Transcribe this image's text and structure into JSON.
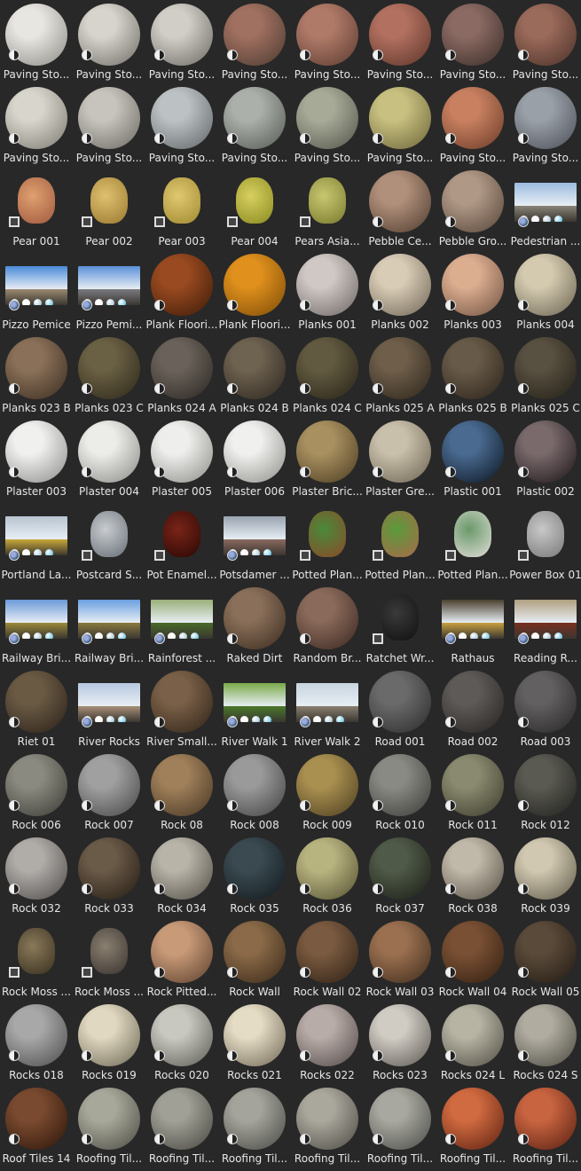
{
  "asset_browser": {
    "columns": 8,
    "items": [
      {
        "label": "Paving Sto...",
        "kind": "sphere",
        "c1": "#e8e6e0",
        "c2": "#8c8a84",
        "badge": "material"
      },
      {
        "label": "Paving Sto...",
        "kind": "sphere",
        "c1": "#d6d4cc",
        "c2": "#6e6c66",
        "badge": "material"
      },
      {
        "label": "Paving Sto...",
        "kind": "sphere",
        "c1": "#d0cec6",
        "c2": "#6a6862",
        "badge": "material"
      },
      {
        "label": "Paving Sto...",
        "kind": "sphere",
        "c1": "#a07060",
        "c2": "#4a3a30",
        "badge": "material"
      },
      {
        "label": "Paving Sto...",
        "kind": "sphere",
        "c1": "#b07a68",
        "c2": "#5a3a30",
        "badge": "material"
      },
      {
        "label": "Paving Sto...",
        "kind": "sphere",
        "c1": "#b27060",
        "c2": "#5a3428",
        "badge": "material"
      },
      {
        "label": "Paving Sto...",
        "kind": "sphere",
        "c1": "#8a6a62",
        "c2": "#3a2c28",
        "badge": "material"
      },
      {
        "label": "Paving Sto...",
        "kind": "sphere",
        "c1": "#9a6a5a",
        "c2": "#4a3028",
        "badge": "material"
      },
      {
        "label": "Paving Sto...",
        "kind": "sphere",
        "c1": "#d8d6cc",
        "c2": "#7a7870",
        "badge": "material"
      },
      {
        "label": "Paving Sto...",
        "kind": "sphere",
        "c1": "#c6c4bc",
        "c2": "#6a6862",
        "badge": "material"
      },
      {
        "label": "Paving Sto...",
        "kind": "sphere",
        "c1": "#bcc2c4",
        "c2": "#5e6466",
        "badge": "material"
      },
      {
        "label": "Paving Sto...",
        "kind": "sphere",
        "c1": "#acb0aa",
        "c2": "#545852",
        "badge": "material"
      },
      {
        "label": "Paving Sto...",
        "kind": "sphere",
        "c1": "#a8aa98",
        "c2": "#52544a",
        "badge": "material"
      },
      {
        "label": "Paving Sto...",
        "kind": "sphere",
        "c1": "#c8c080",
        "c2": "#6a6438",
        "badge": "material"
      },
      {
        "label": "Paving Sto...",
        "kind": "sphere",
        "c1": "#c88060",
        "c2": "#6a3a28",
        "badge": "material"
      },
      {
        "label": "Paving Sto...",
        "kind": "sphere",
        "c1": "#9aa0a8",
        "c2": "#4a4e56",
        "badge": "material"
      },
      {
        "label": "Pear 001",
        "kind": "object",
        "c1": "#e0a070",
        "c2": "#a05a40",
        "badge": "object"
      },
      {
        "label": "Pear 002",
        "kind": "object",
        "c1": "#e0c070",
        "c2": "#9a7a30",
        "badge": "object"
      },
      {
        "label": "Pear 003",
        "kind": "object",
        "c1": "#e0c870",
        "c2": "#a08a30",
        "badge": "object"
      },
      {
        "label": "Pear 004",
        "kind": "object",
        "c1": "#d8d060",
        "c2": "#8a8a20",
        "badge": "object"
      },
      {
        "label": "Pears Asia...",
        "kind": "object",
        "c1": "#c8c870",
        "c2": "#7a7a30",
        "badge": "object"
      },
      {
        "label": "Pebble Ce...",
        "kind": "sphere",
        "c1": "#b0907a",
        "c2": "#4e3a2e",
        "badge": "material"
      },
      {
        "label": "Pebble Gro...",
        "kind": "sphere",
        "c1": "#b09886",
        "c2": "#544438",
        "badge": "material"
      },
      {
        "label": "Pedestrian ...",
        "kind": "pano",
        "c1": "#9cbce0",
        "c2": "#8a8478",
        "badge": "world"
      },
      {
        "label": "Pizzo Pemice",
        "kind": "pano",
        "c1": "#4a8ad8",
        "c2": "#9a8a70",
        "badge": "world"
      },
      {
        "label": "Pizzo Pemi...",
        "kind": "pano",
        "c1": "#5a90d8",
        "c2": "#7a7a80",
        "badge": "world"
      },
      {
        "label": "Plank Floori...",
        "kind": "sphere",
        "c1": "#9a4a20",
        "c2": "#3a1a08",
        "badge": "material"
      },
      {
        "label": "Plank Floori...",
        "kind": "sphere",
        "c1": "#e0901c",
        "c2": "#7a4a08",
        "badge": "material"
      },
      {
        "label": "Planks 001",
        "kind": "sphere",
        "c1": "#d0c8c4",
        "c2": "#6a6460",
        "badge": "material"
      },
      {
        "label": "Planks 002",
        "kind": "sphere",
        "c1": "#d8ccb6",
        "c2": "#6e6454",
        "badge": "material"
      },
      {
        "label": "Planks 003",
        "kind": "sphere",
        "c1": "#dcae90",
        "c2": "#6e5040",
        "badge": "material"
      },
      {
        "label": "Planks 004",
        "kind": "sphere",
        "c1": "#d4cab0",
        "c2": "#6a6250",
        "badge": "material"
      },
      {
        "label": "Planks 023  B",
        "kind": "sphere",
        "c1": "#8a7058",
        "c2": "#3a2c20",
        "badge": "material"
      },
      {
        "label": "Planks 023  C",
        "kind": "sphere",
        "c1": "#6a6044",
        "c2": "#2a2618",
        "badge": "material"
      },
      {
        "label": "Planks 024  A",
        "kind": "sphere",
        "c1": "#6a625a",
        "c2": "#2a2622",
        "badge": "material"
      },
      {
        "label": "Planks 024  B",
        "kind": "sphere",
        "c1": "#6e6250",
        "c2": "#2c261e",
        "badge": "material"
      },
      {
        "label": "Planks 024  C",
        "kind": "sphere",
        "c1": "#625a40",
        "c2": "#262216",
        "badge": "material"
      },
      {
        "label": "Planks 025  A",
        "kind": "sphere",
        "c1": "#6e5e4a",
        "c2": "#2c241a",
        "badge": "material"
      },
      {
        "label": "Planks 025  B",
        "kind": "sphere",
        "c1": "#685a48",
        "c2": "#2a2218",
        "badge": "material"
      },
      {
        "label": "Planks 025  C",
        "kind": "sphere",
        "c1": "#585040",
        "c2": "#221e16",
        "badge": "material"
      },
      {
        "label": "Plaster 003",
        "kind": "sphere",
        "c1": "#f0f0ee",
        "c2": "#8a8a88",
        "badge": "material"
      },
      {
        "label": "Plaster 004",
        "kind": "sphere",
        "c1": "#ecece8",
        "c2": "#888884",
        "badge": "material"
      },
      {
        "label": "Plaster 005",
        "kind": "sphere",
        "c1": "#eeeeec",
        "c2": "#8a8a86",
        "badge": "material"
      },
      {
        "label": "Plaster 006",
        "kind": "sphere",
        "c1": "#f0f0ee",
        "c2": "#8c8c88",
        "badge": "material"
      },
      {
        "label": "Plaster Bric...",
        "kind": "sphere",
        "c1": "#a89060",
        "c2": "#4a3a20",
        "badge": "material"
      },
      {
        "label": "Plaster Gre...",
        "kind": "sphere",
        "c1": "#c8c0aa",
        "c2": "#6a6250",
        "badge": "material"
      },
      {
        "label": "Plastic 001",
        "kind": "sphere",
        "c1": "#4a6a90",
        "c2": "#0a1420",
        "badge": "material"
      },
      {
        "label": "Plastic 002",
        "kind": "sphere",
        "c1": "#7a6a6c",
        "c2": "#1a1416",
        "badge": "material"
      },
      {
        "label": "Portland La...",
        "kind": "pano",
        "c1": "#b8c4d0",
        "c2": "#c8a838",
        "badge": "world"
      },
      {
        "label": "Postcard S...",
        "kind": "object",
        "c1": "#c8ccd0",
        "c2": "#6a7078",
        "badge": "object"
      },
      {
        "label": "Pot Enamel...",
        "kind": "object",
        "c1": "#7a2418",
        "c2": "#2a0804",
        "badge": "object"
      },
      {
        "label": "Potsdamer ...",
        "kind": "pano",
        "c1": "#9aa4b0",
        "c2": "#8a6a60",
        "badge": "world"
      },
      {
        "label": "Potted Plan...",
        "kind": "object",
        "c1": "#4a8a3a",
        "c2": "#8a4a2a",
        "badge": "object"
      },
      {
        "label": "Potted Plan...",
        "kind": "object",
        "c1": "#5a9a3a",
        "c2": "#a86a4a",
        "badge": "object"
      },
      {
        "label": "Potted Plan...",
        "kind": "object",
        "c1": "#6a9a6a",
        "c2": "#e0dcd8",
        "badge": "object"
      },
      {
        "label": "Power Box 01",
        "kind": "object",
        "c1": "#c8c8c8",
        "c2": "#7a7a7a",
        "badge": "object"
      },
      {
        "label": "Railway Bri...",
        "kind": "pano",
        "c1": "#6a9ad8",
        "c2": "#9a8a3a",
        "badge": "world"
      },
      {
        "label": "Railway Bri...",
        "kind": "pano",
        "c1": "#6aa0e0",
        "c2": "#8a7a40",
        "badge": "world"
      },
      {
        "label": "Rainforest ...",
        "kind": "pano",
        "c1": "#9ab07a",
        "c2": "#4a6a2a",
        "badge": "world"
      },
      {
        "label": "Raked Dirt",
        "kind": "sphere",
        "c1": "#8a705a",
        "c2": "#3a2a1e",
        "badge": "material"
      },
      {
        "label": "Random Br...",
        "kind": "sphere",
        "c1": "#8a6a5a",
        "c2": "#3a2620",
        "badge": "material"
      },
      {
        "label": "Ratchet Wr...",
        "kind": "object",
        "c1": "#3a3a3a",
        "c2": "#101010",
        "badge": "object"
      },
      {
        "label": "Rathaus",
        "kind": "pano",
        "c1": "#4a4030",
        "c2": "#c8a040",
        "badge": "world"
      },
      {
        "label": "Reading R...",
        "kind": "pano",
        "c1": "#b0a080",
        "c2": "#7a3020",
        "badge": "world"
      },
      {
        "label": "Riet 01",
        "kind": "sphere",
        "c1": "#6a5a44",
        "c2": "#2a2018",
        "badge": "material"
      },
      {
        "label": "River Rocks",
        "kind": "pano",
        "c1": "#b8c8e0",
        "c2": "#a89078",
        "badge": "world"
      },
      {
        "label": "River Small...",
        "kind": "sphere",
        "c1": "#7a6048",
        "c2": "#2e2216",
        "badge": "material"
      },
      {
        "label": "River Walk 1",
        "kind": "pano",
        "c1": "#7aaa4a",
        "c2": "#4a7a2a",
        "badge": "world"
      },
      {
        "label": "River Walk 2",
        "kind": "pano",
        "c1": "#c8d4e0",
        "c2": "#8a8070",
        "badge": "world"
      },
      {
        "label": "Road 001",
        "kind": "sphere",
        "c1": "#6a6a6a",
        "c2": "#2a2a2a",
        "badge": "material"
      },
      {
        "label": "Road 002",
        "kind": "sphere",
        "c1": "#5e5a58",
        "c2": "#242220",
        "badge": "material"
      },
      {
        "label": "Road 003",
        "kind": "sphere",
        "c1": "#626060",
        "c2": "#262424",
        "badge": "material"
      },
      {
        "label": "Rock 006",
        "kind": "sphere",
        "c1": "#8a8a80",
        "c2": "#3a3a34",
        "badge": "material"
      },
      {
        "label": "Rock 007",
        "kind": "sphere",
        "c1": "#a0a0a0",
        "c2": "#444444",
        "badge": "material"
      },
      {
        "label": "Rock 08",
        "kind": "sphere",
        "c1": "#a0805a",
        "c2": "#443422",
        "badge": "material"
      },
      {
        "label": "Rock 008",
        "kind": "sphere",
        "c1": "#9a9a9a",
        "c2": "#404040",
        "badge": "material"
      },
      {
        "label": "Rock 009",
        "kind": "sphere",
        "c1": "#aa9050",
        "c2": "#4a3c1e",
        "badge": "material"
      },
      {
        "label": "Rock 010",
        "kind": "sphere",
        "c1": "#8a8a84",
        "c2": "#3a3a36",
        "badge": "material"
      },
      {
        "label": "Rock 011",
        "kind": "sphere",
        "c1": "#8a8a70",
        "c2": "#3a3a2c",
        "badge": "material"
      },
      {
        "label": "Rock 012",
        "kind": "sphere",
        "c1": "#5a5a52",
        "c2": "#20201c",
        "badge": "material"
      },
      {
        "label": "Rock 032",
        "kind": "sphere",
        "c1": "#b0aca8",
        "c2": "#4c4a48",
        "badge": "material"
      },
      {
        "label": "Rock 033",
        "kind": "sphere",
        "c1": "#6a5a48",
        "c2": "#221a12",
        "badge": "material"
      },
      {
        "label": "Rock 034",
        "kind": "sphere",
        "c1": "#b8b4a8",
        "c2": "#504c44",
        "badge": "material"
      },
      {
        "label": "Rock 035",
        "kind": "sphere",
        "c1": "#3a4a50",
        "c2": "#10181c",
        "badge": "material"
      },
      {
        "label": "Rock 036",
        "kind": "sphere",
        "c1": "#b8b480",
        "c2": "#524e30",
        "badge": "material"
      },
      {
        "label": "Rock 037",
        "kind": "sphere",
        "c1": "#505a48",
        "c2": "#181c14",
        "badge": "material"
      },
      {
        "label": "Rock 038",
        "kind": "sphere",
        "c1": "#c0b8a8",
        "c2": "#564e44",
        "badge": "material"
      },
      {
        "label": "Rock 039",
        "kind": "sphere",
        "c1": "#d0c8b0",
        "c2": "#5e5848",
        "badge": "material"
      },
      {
        "label": "Rock Moss ...",
        "kind": "object",
        "c1": "#8a7a5a",
        "c2": "#3a3020",
        "badge": "object"
      },
      {
        "label": "Rock Moss ...",
        "kind": "object",
        "c1": "#8a8070",
        "c2": "#3a3430",
        "badge": "object"
      },
      {
        "label": "Rock Pitted...",
        "kind": "sphere",
        "c1": "#c89a78",
        "c2": "#5a3e2c",
        "badge": "material"
      },
      {
        "label": "Rock Wall",
        "kind": "sphere",
        "c1": "#8a6a48",
        "c2": "#3a2818",
        "badge": "material"
      },
      {
        "label": "Rock Wall 02",
        "kind": "sphere",
        "c1": "#7a5a40",
        "c2": "#2e2014",
        "badge": "material"
      },
      {
        "label": "Rock Wall 03",
        "kind": "sphere",
        "c1": "#9a7050",
        "c2": "#3e2a1a",
        "badge": "material"
      },
      {
        "label": "Rock Wall 04",
        "kind": "sphere",
        "c1": "#7a5034",
        "c2": "#301e10",
        "badge": "material"
      },
      {
        "label": "Rock Wall 05",
        "kind": "sphere",
        "c1": "#5a4a3a",
        "c2": "#221a12",
        "badge": "material"
      },
      {
        "label": "Rocks 018",
        "kind": "sphere",
        "c1": "#a8a8a8",
        "c2": "#4a4a4a",
        "badge": "material"
      },
      {
        "label": "Rocks 019",
        "kind": "sphere",
        "c1": "#e0d8c0",
        "c2": "#6a6452",
        "badge": "material"
      },
      {
        "label": "Rocks 020",
        "kind": "sphere",
        "c1": "#c8c8c0",
        "c2": "#5a5a54",
        "badge": "material"
      },
      {
        "label": "Rocks 021",
        "kind": "sphere",
        "c1": "#e4dcc4",
        "c2": "#6e6654",
        "badge": "material"
      },
      {
        "label": "Rocks 022",
        "kind": "sphere",
        "c1": "#b8aca8",
        "c2": "#504846",
        "badge": "material"
      },
      {
        "label": "Rocks 023",
        "kind": "sphere",
        "c1": "#d0ccc4",
        "c2": "#5a5650",
        "badge": "material"
      },
      {
        "label": "Rocks 024  L",
        "kind": "sphere",
        "c1": "#b8b4a4",
        "c2": "#4e4c42",
        "badge": "material"
      },
      {
        "label": "Rocks 024  S",
        "kind": "sphere",
        "c1": "#b0aca0",
        "c2": "#4a4840",
        "badge": "material"
      },
      {
        "label": "Roof Tiles 14",
        "kind": "sphere",
        "c1": "#7a4a30",
        "c2": "#2a1408",
        "badge": "material"
      },
      {
        "label": "Roofing Til...",
        "kind": "sphere",
        "c1": "#a8a89a",
        "c2": "#4a4a42",
        "badge": "material"
      },
      {
        "label": "Roofing Til...",
        "kind": "sphere",
        "c1": "#a0a096",
        "c2": "#464640",
        "badge": "material"
      },
      {
        "label": "Roofing Til...",
        "kind": "sphere",
        "c1": "#a4a49c",
        "c2": "#484844",
        "badge": "material"
      },
      {
        "label": "Roofing Til...",
        "kind": "sphere",
        "c1": "#aaa89c",
        "c2": "#4a4842",
        "badge": "material"
      },
      {
        "label": "Roofing Til...",
        "kind": "sphere",
        "c1": "#a8a8a0",
        "c2": "#4a4a46",
        "badge": "material"
      },
      {
        "label": "Roofing Til...",
        "kind": "sphere",
        "c1": "#d06a40",
        "c2": "#5a2010",
        "badge": "material"
      },
      {
        "label": "Roofing Til...",
        "kind": "sphere",
        "c1": "#c86440",
        "c2": "#561e10",
        "badge": "material"
      }
    ]
  }
}
